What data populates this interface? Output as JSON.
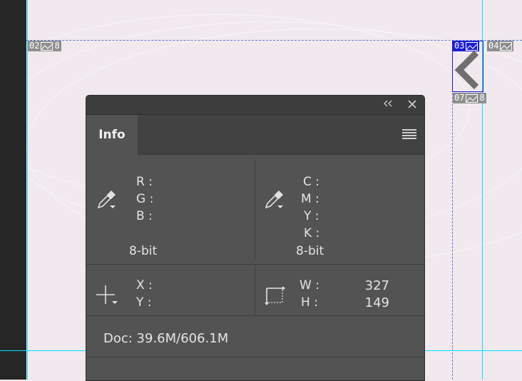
{
  "canvas": {
    "slices": [
      {
        "number": "02",
        "suffix": "8",
        "active": false
      },
      {
        "number": "03",
        "suffix": "",
        "active": true
      },
      {
        "number": "04",
        "suffix": "",
        "active": false
      },
      {
        "number": "07",
        "suffix": "8",
        "active": false
      }
    ],
    "guide_color": "#00e5ff",
    "slice_active_color": "#1c1cd9"
  },
  "panel": {
    "collapse_icon": "double-chevron-left-icon",
    "close_icon": "close-icon",
    "tab_label": "Info",
    "menu_icon": "hamburger-menu-icon",
    "rgb": {
      "icon": "eyedropper-icon",
      "labels": [
        "R :",
        "G :",
        "B :"
      ],
      "bit_depth": "8-bit"
    },
    "cmyk": {
      "icon": "eyedropper-icon",
      "labels": [
        "C :",
        "M :",
        "Y :",
        "K :"
      ],
      "bit_depth": "8-bit"
    },
    "position": {
      "icon": "crosshair-icon",
      "labels": [
        "X :",
        "Y :"
      ]
    },
    "size": {
      "icon": "selection-size-icon",
      "w_label": "W :",
      "h_label": "H :",
      "w_value": "327",
      "h_value": "149"
    },
    "doc_info": "Doc: 39.6M/606.1M"
  }
}
